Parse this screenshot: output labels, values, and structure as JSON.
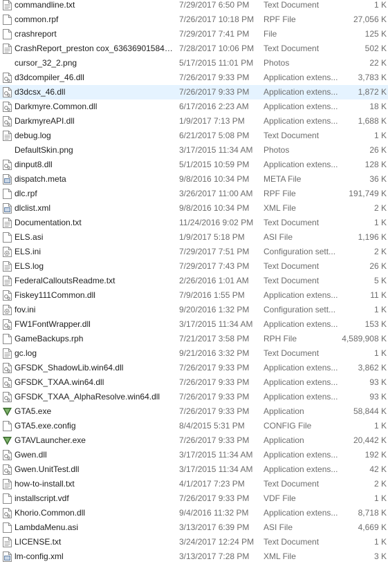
{
  "files": [
    {
      "name": "commandline.txt",
      "date": "7/29/2017 6:50 PM",
      "type": "Text Document",
      "size": "1 K",
      "icon": "text-document-icon"
    },
    {
      "name": "common.rpf",
      "date": "7/26/2017 10:18 PM",
      "type": "RPF File",
      "size": "27,056 K",
      "icon": "generic-file-icon"
    },
    {
      "name": "crashreport",
      "date": "7/29/2017 7:41 PM",
      "type": "File",
      "size": "125 K",
      "icon": "generic-file-icon"
    },
    {
      "name": "CrashReport_preston cox_6363690158477...",
      "date": "7/28/2017 10:06 PM",
      "type": "Text Document",
      "size": "502 K",
      "icon": "text-document-icon"
    },
    {
      "name": "cursor_32_2.png",
      "date": "5/17/2015 11:01 PM",
      "type": "Photos",
      "size": "22 K",
      "icon": "blank-icon"
    },
    {
      "name": "d3dcompiler_46.dll",
      "date": "7/26/2017 9:33 PM",
      "type": "Application extens...",
      "size": "3,783 K",
      "icon": "dll-file-icon"
    },
    {
      "name": "d3dcsx_46.dll",
      "date": "7/26/2017 9:33 PM",
      "type": "Application extens...",
      "size": "1,872 K",
      "icon": "dll-file-icon",
      "selected": true
    },
    {
      "name": "Darkmyre.Common.dll",
      "date": "6/17/2016 2:23 AM",
      "type": "Application extens...",
      "size": "18 K",
      "icon": "dll-file-icon"
    },
    {
      "name": "DarkmyreAPI.dll",
      "date": "1/9/2017 7:13 PM",
      "type": "Application extens...",
      "size": "1,688 K",
      "icon": "dll-file-icon"
    },
    {
      "name": "debug.log",
      "date": "6/21/2017 5:08 PM",
      "type": "Text Document",
      "size": "1 K",
      "icon": "text-document-icon"
    },
    {
      "name": "DefaultSkin.png",
      "date": "3/17/2015 11:34 AM",
      "type": "Photos",
      "size": "26 K",
      "icon": "blank-icon"
    },
    {
      "name": "dinput8.dll",
      "date": "5/1/2015 10:59 PM",
      "type": "Application extens...",
      "size": "128 K",
      "icon": "dll-file-icon"
    },
    {
      "name": "dispatch.meta",
      "date": "9/8/2016 10:34 PM",
      "type": "META File",
      "size": "36 K",
      "icon": "meta-file-icon"
    },
    {
      "name": "dlc.rpf",
      "date": "3/26/2017 11:00 AM",
      "type": "RPF File",
      "size": "191,749 K",
      "icon": "generic-file-icon"
    },
    {
      "name": "dlclist.xml",
      "date": "9/8/2016 10:34 PM",
      "type": "XML File",
      "size": "2 K",
      "icon": "meta-file-icon"
    },
    {
      "name": "Documentation.txt",
      "date": "11/24/2016 9:02 PM",
      "type": "Text Document",
      "size": "1 K",
      "icon": "text-document-icon"
    },
    {
      "name": "ELS.asi",
      "date": "1/9/2017 5:18 PM",
      "type": "ASI File",
      "size": "1,196 K",
      "icon": "generic-file-icon"
    },
    {
      "name": "ELS.ini",
      "date": "7/29/2017 7:51 PM",
      "type": "Configuration sett...",
      "size": "2 K",
      "icon": "config-settings-icon"
    },
    {
      "name": "ELS.log",
      "date": "7/29/2017 7:43 PM",
      "type": "Text Document",
      "size": "26 K",
      "icon": "text-document-icon"
    },
    {
      "name": "FederalCalloutsReadme.txt",
      "date": "2/26/2016 1:01 AM",
      "type": "Text Document",
      "size": "5 K",
      "icon": "text-document-icon"
    },
    {
      "name": "Fiskey111Common.dll",
      "date": "7/9/2016 1:55 PM",
      "type": "Application extens...",
      "size": "11 K",
      "icon": "dll-file-icon"
    },
    {
      "name": "fov.ini",
      "date": "9/20/2016 1:32 PM",
      "type": "Configuration sett...",
      "size": "1 K",
      "icon": "config-settings-icon"
    },
    {
      "name": "FW1FontWrapper.dll",
      "date": "3/17/2015 11:34 AM",
      "type": "Application extens...",
      "size": "153 K",
      "icon": "dll-file-icon"
    },
    {
      "name": "GameBackups.rph",
      "date": "7/21/2017 3:58 PM",
      "type": "RPH File",
      "size": "4,589,908 K",
      "icon": "generic-file-icon"
    },
    {
      "name": "gc.log",
      "date": "9/21/2016 3:32 PM",
      "type": "Text Document",
      "size": "1 K",
      "icon": "text-document-icon"
    },
    {
      "name": "GFSDK_ShadowLib.win64.dll",
      "date": "7/26/2017 9:33 PM",
      "type": "Application extens...",
      "size": "3,862 K",
      "icon": "dll-file-icon"
    },
    {
      "name": "GFSDK_TXAA.win64.dll",
      "date": "7/26/2017 9:33 PM",
      "type": "Application extens...",
      "size": "93 K",
      "icon": "dll-file-icon"
    },
    {
      "name": "GFSDK_TXAA_AlphaResolve.win64.dll",
      "date": "7/26/2017 9:33 PM",
      "type": "Application extens...",
      "size": "93 K",
      "icon": "dll-file-icon"
    },
    {
      "name": "GTA5.exe",
      "date": "7/26/2017 9:33 PM",
      "type": "Application",
      "size": "58,844 K",
      "icon": "gta-v-logo-icon"
    },
    {
      "name": "GTA5.exe.config",
      "date": "8/4/2015 5:31 PM",
      "type": "CONFIG File",
      "size": "1 K",
      "icon": "generic-file-icon"
    },
    {
      "name": "GTAVLauncher.exe",
      "date": "7/26/2017 9:33 PM",
      "type": "Application",
      "size": "20,442 K",
      "icon": "gta-v-logo-icon"
    },
    {
      "name": "Gwen.dll",
      "date": "3/17/2015 11:34 AM",
      "type": "Application extens...",
      "size": "192 K",
      "icon": "dll-file-icon"
    },
    {
      "name": "Gwen.UnitTest.dll",
      "date": "3/17/2015 11:34 AM",
      "type": "Application extens...",
      "size": "42 K",
      "icon": "dll-file-icon"
    },
    {
      "name": "how-to-install.txt",
      "date": "4/1/2017 7:23 PM",
      "type": "Text Document",
      "size": "2 K",
      "icon": "text-document-icon"
    },
    {
      "name": "installscript.vdf",
      "date": "7/26/2017 9:33 PM",
      "type": "VDF File",
      "size": "1 K",
      "icon": "generic-file-icon"
    },
    {
      "name": "Khorio.Common.dll",
      "date": "9/4/2016 11:32 PM",
      "type": "Application extens...",
      "size": "8,718 K",
      "icon": "dll-file-icon"
    },
    {
      "name": "LambdaMenu.asi",
      "date": "3/13/2017 6:39 PM",
      "type": "ASI File",
      "size": "4,669 K",
      "icon": "generic-file-icon"
    },
    {
      "name": "LICENSE.txt",
      "date": "3/24/2017 12:24 PM",
      "type": "Text Document",
      "size": "1 K",
      "icon": "text-document-icon"
    },
    {
      "name": "lm-config.xml",
      "date": "3/13/2017 7:28 PM",
      "type": "XML File",
      "size": "3 K",
      "icon": "meta-file-icon"
    }
  ]
}
